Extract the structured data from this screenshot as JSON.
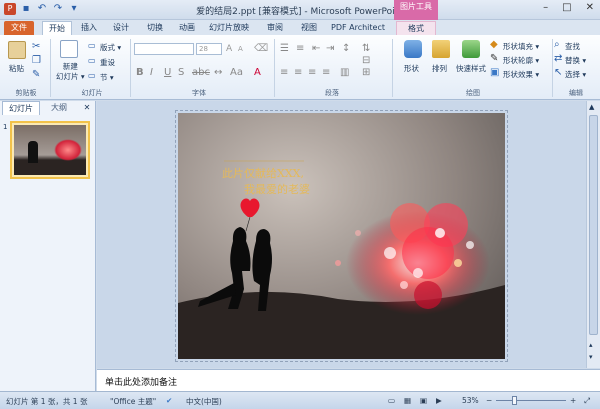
{
  "window": {
    "title": "爱的结局2.ppt [兼容模式] - Microsoft PowerPoint",
    "context_tool_label": "图片工具",
    "controls": [
      "–",
      "□",
      "✕"
    ]
  },
  "tabs": [
    {
      "label": "文件"
    },
    {
      "label": "开始"
    },
    {
      "label": "插入"
    },
    {
      "label": "设计"
    },
    {
      "label": "切换"
    },
    {
      "label": "动画"
    },
    {
      "label": "幻灯片放映"
    },
    {
      "label": "审阅"
    },
    {
      "label": "视图"
    },
    {
      "label": "PDF Architect"
    },
    {
      "label": "格式"
    }
  ],
  "ribbon": {
    "clipboard": {
      "paste": "粘贴",
      "label": "剪贴板"
    },
    "slides": {
      "new_slide": "新建\n幻灯片 ▾",
      "layout": "版式 ▾",
      "reset": "重设",
      "section": "节 ▾",
      "label": "幻灯片"
    },
    "font": {
      "size": "28",
      "label": "字体"
    },
    "paragraph": {
      "label": "段落"
    },
    "drawing": {
      "shapes": "形状",
      "arrange": "排列",
      "quick_styles": "快速样式",
      "fill": "形状填充 ▾",
      "outline": "形状轮廓 ▾",
      "effect": "形状效果 ▾",
      "label": "绘图"
    },
    "editing": {
      "find": "查找",
      "replace": "替换 ▾",
      "select": "选择 ▾",
      "label": "编辑"
    }
  },
  "left_pane": {
    "tab_slides": "幻灯片",
    "tab_outline": "大纲",
    "close": "✕",
    "slide_number": "1"
  },
  "slide": {
    "line1": "此片仅献给XXX,",
    "line2": "我最爱的老婆"
  },
  "notes": {
    "placeholder": "单击此处添加备注"
  },
  "status": {
    "slide_info": "幻灯片 第 1 张，共 1 张",
    "theme": "\"Office 主题\"",
    "language": "中文(中国)",
    "zoom": "53%"
  }
}
